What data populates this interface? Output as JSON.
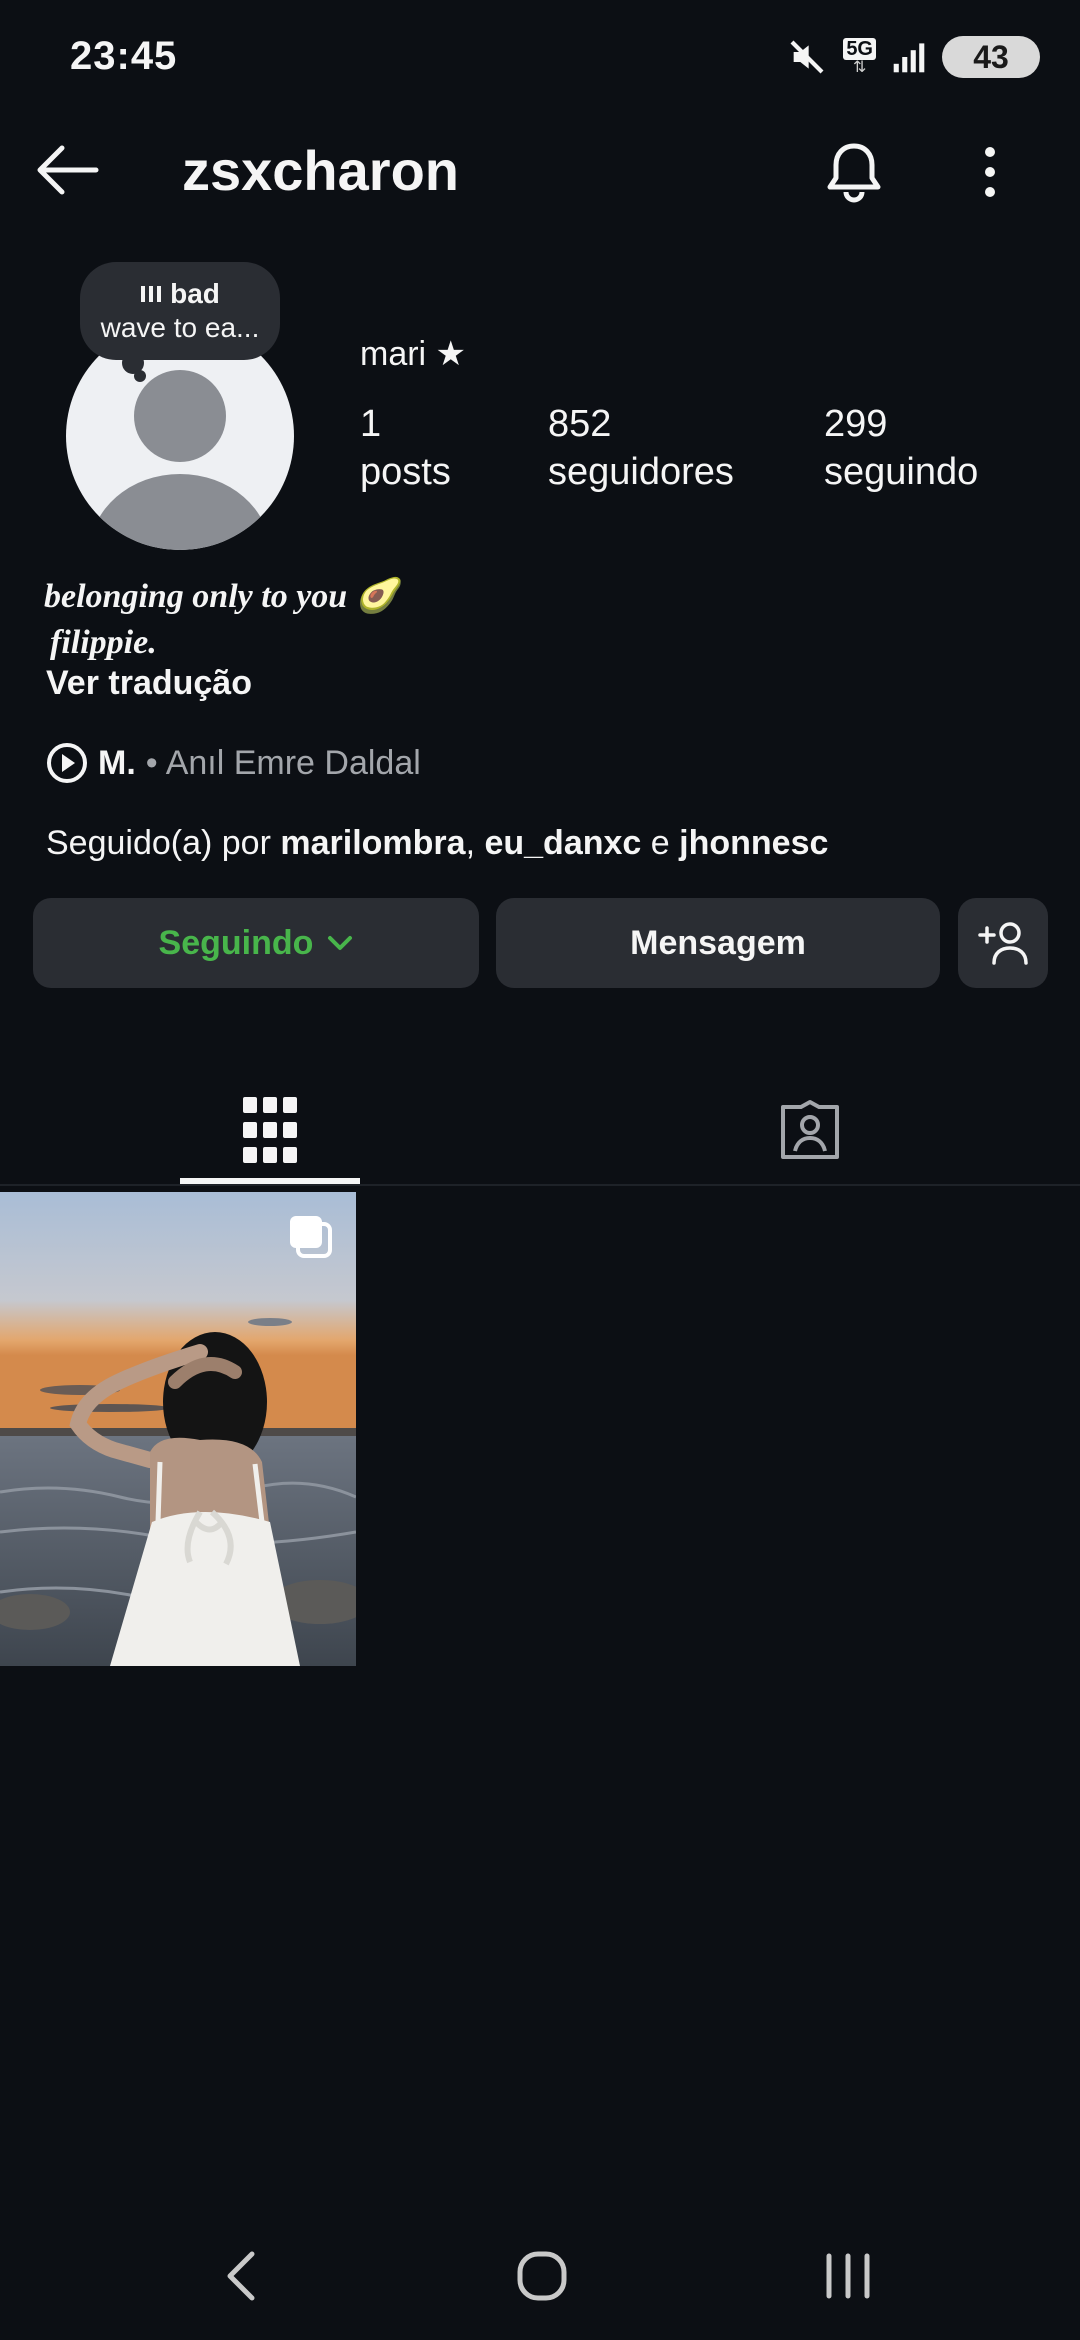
{
  "status_bar": {
    "time": "23:45",
    "network": "5G",
    "battery": "43"
  },
  "header": {
    "username": "zsxcharon"
  },
  "note": {
    "line1": "bad",
    "line2": "wave to ea..."
  },
  "profile": {
    "display_name": "mari ★",
    "stats": [
      {
        "value": "1",
        "label": "posts"
      },
      {
        "value": "852",
        "label": "seguidores"
      },
      {
        "value": "299",
        "label": "seguindo"
      }
    ],
    "bio_line1": "belonging only to you 🥑",
    "bio_line2": "filippie.",
    "translate_label": "Ver tradução",
    "music": {
      "song": "M.",
      "separator": "•",
      "artist": "Anıl Emre Daldal"
    },
    "followed_by": {
      "prefix": "Seguido(a) por ",
      "user1": "marilombra",
      "sep1": ", ",
      "user2": "eu_danxc",
      "sep2": " e ",
      "user3": "jhonnesc"
    }
  },
  "actions": {
    "following_label": "Seguindo",
    "message_label": "Mensagem"
  },
  "colors": {
    "accent_green": "#48b54b",
    "background": "#0c0f14",
    "button_bg": "#2a2d33"
  }
}
